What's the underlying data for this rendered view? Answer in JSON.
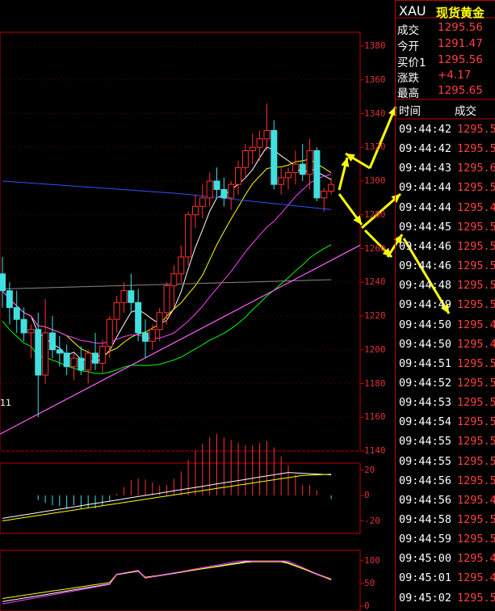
{
  "quote": {
    "symbol": "XAU",
    "name": "现货黄金",
    "rows": [
      {
        "label": "成交",
        "value": "1295.56"
      },
      {
        "label": "今开",
        "value": "1291.47"
      },
      {
        "label": "买价1",
        "value": "1295.56"
      },
      {
        "label": "涨跌",
        "value": "+4.17"
      },
      {
        "label": "最高",
        "value": "1295.65"
      }
    ]
  },
  "ticks_header": {
    "time": "时间",
    "price": "成交"
  },
  "ticks": [
    {
      "t": "09:44:42",
      "p": "1295.5"
    },
    {
      "t": "09:44:42",
      "p": "1295.5"
    },
    {
      "t": "09:44:43",
      "p": "1295.6"
    },
    {
      "t": "09:44:44",
      "p": "1295.5"
    },
    {
      "t": "09:44:44",
      "p": "1295.4"
    },
    {
      "t": "09:44:45",
      "p": "1295.5"
    },
    {
      "t": "09:44:46",
      "p": "1295.5"
    },
    {
      "t": "09:44:46",
      "p": "1295.5"
    },
    {
      "t": "09:44:48",
      "p": "1295.5"
    },
    {
      "t": "09:44:49",
      "p": "1295.5"
    },
    {
      "t": "09:44:50",
      "p": "1295.4"
    },
    {
      "t": "09:44:50",
      "p": "1295.4"
    },
    {
      "t": "09:44:51",
      "p": "1295.5"
    },
    {
      "t": "09:44:52",
      "p": "1295.5"
    },
    {
      "t": "09:44:53",
      "p": "1295.5"
    },
    {
      "t": "09:44:54",
      "p": "1295.5"
    },
    {
      "t": "09:44:55",
      "p": "1295.5"
    },
    {
      "t": "09:44:55",
      "p": "1295.5"
    },
    {
      "t": "09:44:56",
      "p": "1295.5"
    },
    {
      "t": "09:44:56",
      "p": "1295.4"
    },
    {
      "t": "09:44:58",
      "p": "1295.5"
    },
    {
      "t": "09:44:59",
      "p": "1295.5"
    },
    {
      "t": "09:45:00",
      "p": "1295.4"
    },
    {
      "t": "09:45:01",
      "p": "1295.4"
    },
    {
      "t": "09:45:02",
      "p": "1295.5"
    }
  ],
  "chart_data": [
    {
      "type": "candlestick",
      "y_ticks": [
        1380,
        1360,
        1340,
        1320,
        1300,
        1280,
        1260,
        1240,
        1220,
        1200,
        1180,
        1160,
        1140
      ],
      "ylim": [
        1140,
        1390
      ],
      "annotation": "11",
      "colors": {
        "up": "#ff3030",
        "down": "#40e0e0",
        "ma5": "#ffffff",
        "ma10": "#ffff00",
        "ma20": "#ff40ff",
        "ma30": "#00ff00",
        "ma60": "#3050ff",
        "ma120": "#888888",
        "trendline": "#ff60ff",
        "arrow": "#ffff00"
      },
      "candles": [
        {
          "o": 1245,
          "h": 1255,
          "l": 1225,
          "c": 1235
        },
        {
          "o": 1235,
          "h": 1240,
          "l": 1215,
          "c": 1225
        },
        {
          "o": 1225,
          "h": 1235,
          "l": 1210,
          "c": 1218
        },
        {
          "o": 1218,
          "h": 1225,
          "l": 1205,
          "c": 1210
        },
        {
          "o": 1210,
          "h": 1215,
          "l": 1195,
          "c": 1212
        },
        {
          "o": 1212,
          "h": 1222,
          "l": 1160,
          "c": 1185
        },
        {
          "o": 1185,
          "h": 1230,
          "l": 1180,
          "c": 1210
        },
        {
          "o": 1210,
          "h": 1220,
          "l": 1195,
          "c": 1200
        },
        {
          "o": 1200,
          "h": 1208,
          "l": 1190,
          "c": 1198
        },
        {
          "o": 1198,
          "h": 1203,
          "l": 1185,
          "c": 1190
        },
        {
          "o": 1190,
          "h": 1198,
          "l": 1182,
          "c": 1195
        },
        {
          "o": 1195,
          "h": 1202,
          "l": 1185,
          "c": 1188
        },
        {
          "o": 1188,
          "h": 1200,
          "l": 1180,
          "c": 1198
        },
        {
          "o": 1198,
          "h": 1210,
          "l": 1188,
          "c": 1192
        },
        {
          "o": 1192,
          "h": 1206,
          "l": 1186,
          "c": 1202
        },
        {
          "o": 1202,
          "h": 1220,
          "l": 1195,
          "c": 1218
        },
        {
          "o": 1218,
          "h": 1232,
          "l": 1210,
          "c": 1228
        },
        {
          "o": 1228,
          "h": 1240,
          "l": 1222,
          "c": 1235
        },
        {
          "o": 1235,
          "h": 1245,
          "l": 1222,
          "c": 1228
        },
        {
          "o": 1228,
          "h": 1236,
          "l": 1205,
          "c": 1210
        },
        {
          "o": 1210,
          "h": 1218,
          "l": 1195,
          "c": 1205
        },
        {
          "o": 1205,
          "h": 1215,
          "l": 1200,
          "c": 1212
        },
        {
          "o": 1212,
          "h": 1225,
          "l": 1205,
          "c": 1222
        },
        {
          "o": 1222,
          "h": 1240,
          "l": 1215,
          "c": 1238
        },
        {
          "o": 1238,
          "h": 1250,
          "l": 1225,
          "c": 1245
        },
        {
          "o": 1245,
          "h": 1262,
          "l": 1240,
          "c": 1255
        },
        {
          "o": 1255,
          "h": 1282,
          "l": 1250,
          "c": 1280
        },
        {
          "o": 1280,
          "h": 1292,
          "l": 1272,
          "c": 1285
        },
        {
          "o": 1285,
          "h": 1298,
          "l": 1278,
          "c": 1290
        },
        {
          "o": 1290,
          "h": 1305,
          "l": 1285,
          "c": 1300
        },
        {
          "o": 1300,
          "h": 1308,
          "l": 1290,
          "c": 1295
        },
        {
          "o": 1295,
          "h": 1302,
          "l": 1285,
          "c": 1290
        },
        {
          "o": 1290,
          "h": 1300,
          "l": 1283,
          "c": 1298
        },
        {
          "o": 1298,
          "h": 1312,
          "l": 1292,
          "c": 1308
        },
        {
          "o": 1308,
          "h": 1322,
          "l": 1302,
          "c": 1318
        },
        {
          "o": 1318,
          "h": 1328,
          "l": 1310,
          "c": 1320
        },
        {
          "o": 1320,
          "h": 1330,
          "l": 1312,
          "c": 1325
        },
        {
          "o": 1325,
          "h": 1346,
          "l": 1318,
          "c": 1330
        },
        {
          "o": 1330,
          "h": 1336,
          "l": 1295,
          "c": 1298
        },
        {
          "o": 1298,
          "h": 1308,
          "l": 1292,
          "c": 1302
        },
        {
          "o": 1302,
          "h": 1308,
          "l": 1295,
          "c": 1305
        },
        {
          "o": 1305,
          "h": 1318,
          "l": 1298,
          "c": 1310
        },
        {
          "o": 1310,
          "h": 1322,
          "l": 1300,
          "c": 1304
        },
        {
          "o": 1304,
          "h": 1325,
          "l": 1295,
          "c": 1318
        },
        {
          "o": 1318,
          "h": 1320,
          "l": 1288,
          "c": 1290
        },
        {
          "o": 1290,
          "h": 1296,
          "l": 1282,
          "c": 1294
        },
        {
          "o": 1294,
          "h": 1302,
          "l": 1292,
          "c": 1298
        }
      ]
    },
    {
      "type": "bar",
      "y_ticks": [
        20,
        0,
        -20
      ],
      "ylim": [
        -28,
        28
      ]
    },
    {
      "type": "line",
      "y_ticks": [
        100,
        50,
        0
      ],
      "ylim": [
        -5,
        110
      ]
    }
  ]
}
